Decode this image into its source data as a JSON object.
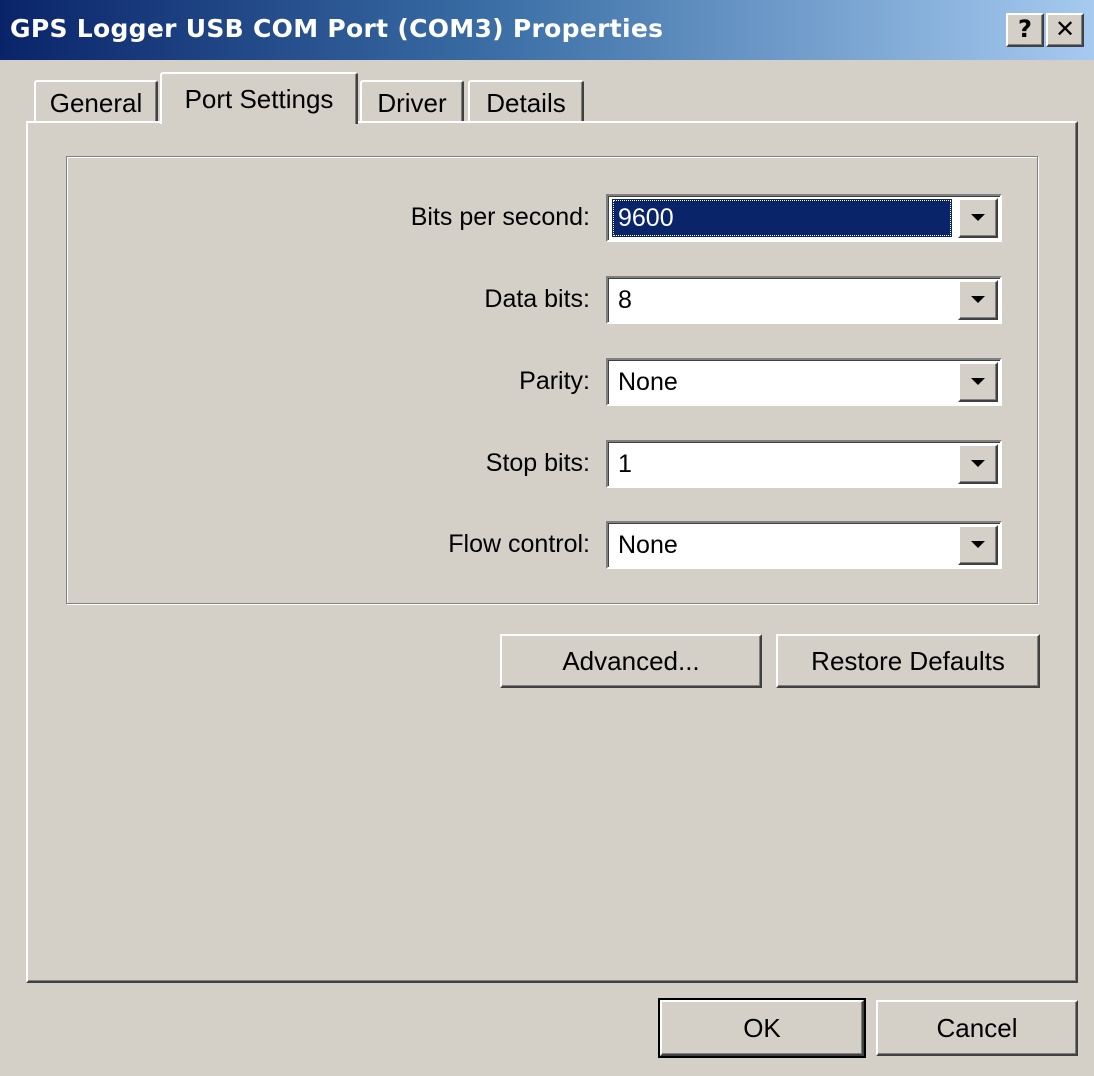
{
  "window": {
    "title": "GPS Logger USB COM Port (COM3) Properties",
    "help_glyph": "?",
    "close_glyph": "✕"
  },
  "tabs": [
    {
      "label": "General",
      "active": false
    },
    {
      "label": "Port Settings",
      "active": true
    },
    {
      "label": "Driver",
      "active": false
    },
    {
      "label": "Details",
      "active": false
    }
  ],
  "settings": {
    "bits_per_second": {
      "label": "Bits per second:",
      "value": "9600"
    },
    "data_bits": {
      "label": "Data bits:",
      "value": "8"
    },
    "parity": {
      "label": "Parity:",
      "value": "None"
    },
    "stop_bits": {
      "label": "Stop bits:",
      "value": "1"
    },
    "flow_control": {
      "label": "Flow control:",
      "value": "None"
    }
  },
  "buttons": {
    "advanced": "Advanced...",
    "restore_defaults": "Restore Defaults",
    "ok": "OK",
    "cancel": "Cancel"
  },
  "colors": {
    "titlebar_start": "#0a246a",
    "titlebar_end": "#a6caf0",
    "face": "#d4d0c8",
    "selection": "#0a246a"
  }
}
